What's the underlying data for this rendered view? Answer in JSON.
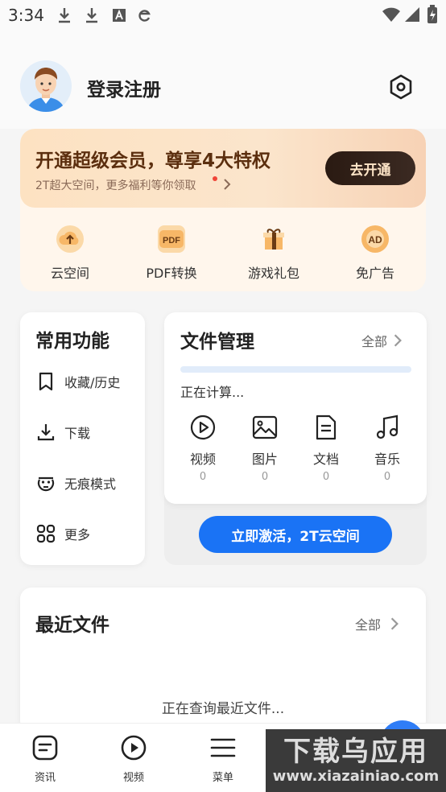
{
  "status_bar": {
    "time": "3:34"
  },
  "header": {
    "login_label": "登录注册"
  },
  "vip": {
    "title": "开通超级会员，尊享4大特权",
    "subtitle": "2T超大空间，更多福利等你领取",
    "button": "去开通",
    "perks": [
      {
        "label": "云空间",
        "icon": "cloud-upload-icon"
      },
      {
        "label": "PDF转换",
        "icon": "pdf-icon"
      },
      {
        "label": "游戏礼包",
        "icon": "gift-icon"
      },
      {
        "label": "免广告",
        "icon": "ad-icon"
      }
    ]
  },
  "common": {
    "title": "常用功能",
    "items": [
      {
        "label": "收藏/历史",
        "icon": "bookmark-icon"
      },
      {
        "label": "下载",
        "icon": "download-icon"
      },
      {
        "label": "无痕模式",
        "icon": "incognito-icon"
      },
      {
        "label": "更多",
        "icon": "grid-icon"
      }
    ]
  },
  "file_manager": {
    "title": "文件管理",
    "all_label": "全部",
    "status": "正在计算...",
    "progress": 0,
    "categories": [
      {
        "label": "视频",
        "count": "0",
        "icon": "video-icon"
      },
      {
        "label": "图片",
        "count": "0",
        "icon": "image-icon"
      },
      {
        "label": "文档",
        "count": "0",
        "icon": "document-icon"
      },
      {
        "label": "音乐",
        "count": "0",
        "icon": "music-icon"
      }
    ],
    "activate_button": "立即激活，2T云空间"
  },
  "recent": {
    "title": "最近文件",
    "all_label": "全部",
    "status": "正在查询最近文件..."
  },
  "bottom_nav": [
    {
      "label": "资讯",
      "icon": "news-icon"
    },
    {
      "label": "视频",
      "icon": "play-icon"
    },
    {
      "label": "菜单",
      "icon": "menu-icon"
    }
  ],
  "watermark": {
    "line1": "下载乌应用",
    "line2": "www.xiazainiao.com"
  },
  "colors": {
    "accent": "#1a73f5",
    "vip_text": "#5b2e0e",
    "vip_button": "#2a1a12"
  }
}
